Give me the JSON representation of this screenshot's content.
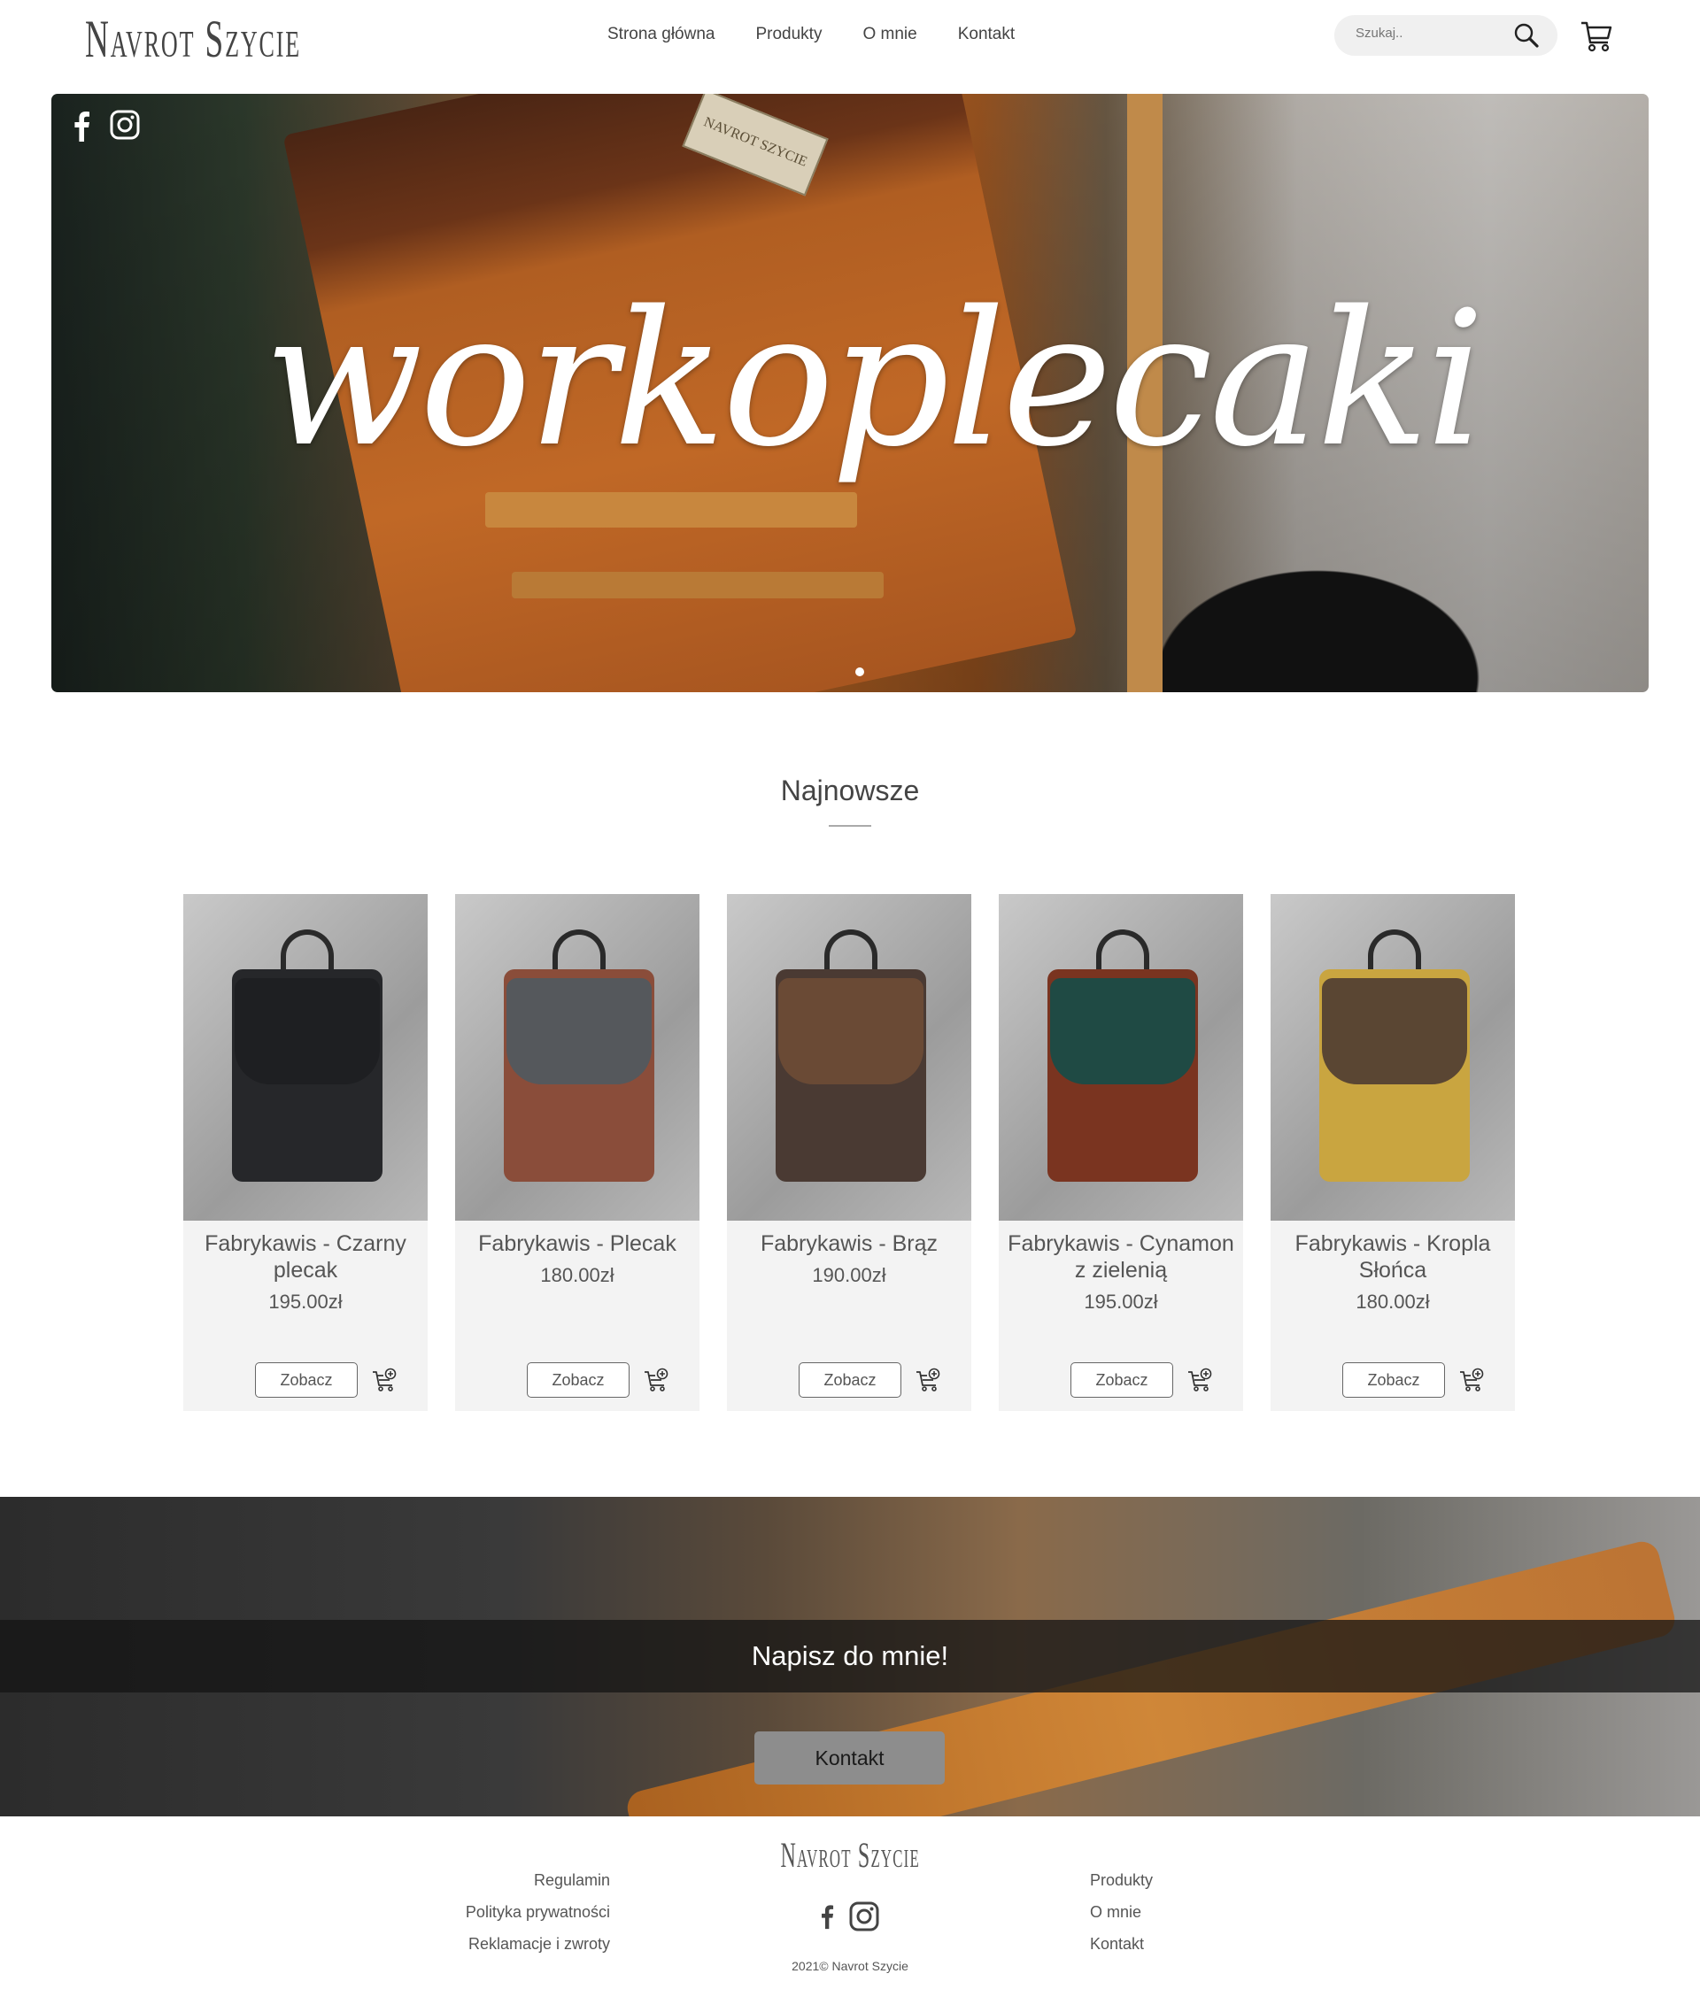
{
  "brand": {
    "logo": "Navrot Szycie"
  },
  "nav": {
    "items": [
      "Strona główna",
      "Produkty",
      "O mnie",
      "Kontakt"
    ]
  },
  "search": {
    "placeholder": "Szukaj.."
  },
  "icons": {
    "search": "search-icon",
    "cart": "cart-icon",
    "facebook": "facebook-icon",
    "instagram": "instagram-icon",
    "add_to_cart": "add-to-cart-icon"
  },
  "hero": {
    "title": "workoplecaki"
  },
  "section": {
    "title": "Najnowsze"
  },
  "products": [
    {
      "name": "Fabrykawis - Czarny plecak",
      "price": "195.00zł",
      "button": "Zobacz",
      "colors": {
        "flap": "#1e1f22",
        "body": "#26272a"
      }
    },
    {
      "name": "Fabrykawis - Plecak",
      "price": "180.00zł",
      "button": "Zobacz",
      "colors": {
        "flap": "#55585c",
        "body": "#8a4d3a"
      }
    },
    {
      "name": "Fabrykawis - Brąz",
      "price": "190.00zł",
      "button": "Zobacz",
      "colors": {
        "flap": "#6a4a35",
        "body": "#4a3a33"
      }
    },
    {
      "name": "Fabrykawis - Cynamon z zielenią",
      "price": "195.00zł",
      "button": "Zobacz",
      "colors": {
        "flap": "#1f4a44",
        "body": "#7a3420"
      }
    },
    {
      "name": "Fabrykawis - Kropla Słońca",
      "price": "180.00zł",
      "button": "Zobacz",
      "colors": {
        "flap": "#5a4633",
        "body": "#c9a540"
      }
    }
  ],
  "banner": {
    "message": "Napisz do mnie!",
    "button": "Kontakt"
  },
  "footer": {
    "left_links": [
      "Regulamin",
      "Polityka prywatności",
      "Reklamacje i zwroty"
    ],
    "right_links": [
      "Produkty",
      "O mnie",
      "Kontakt"
    ],
    "logo": "Navrot Szycie",
    "copyright": "2021© Navrot Szycie"
  }
}
